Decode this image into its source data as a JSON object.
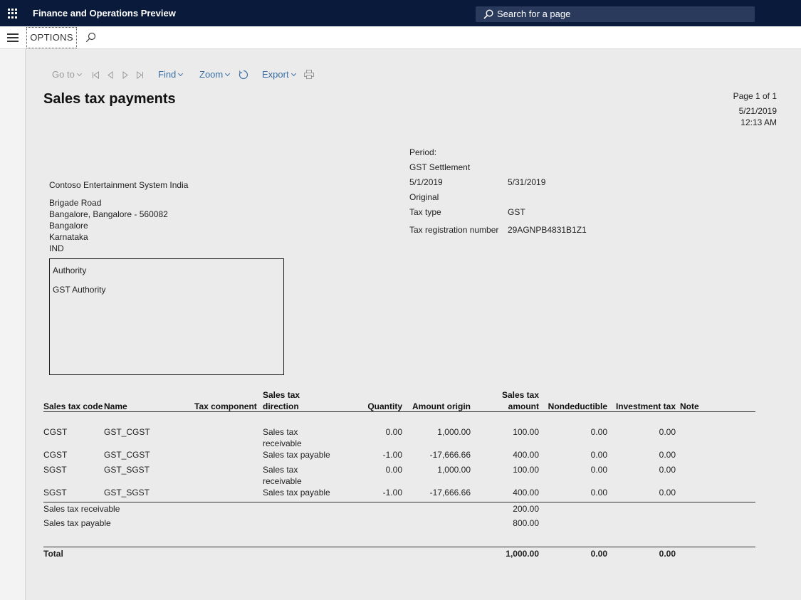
{
  "app": {
    "title": "Finance and Operations Preview",
    "search_placeholder": "Search for a page"
  },
  "actionbar": {
    "options_label": "OPTIONS"
  },
  "report_toolbar": {
    "goto_label": "Go to",
    "find_label": "Find",
    "zoom_label": "Zoom",
    "export_label": "Export"
  },
  "report": {
    "title": "Sales tax payments",
    "page_info": "Page 1 of 1",
    "date": "5/21/2019",
    "time": "12:13 AM",
    "company": {
      "name": "Contoso Entertainment System India",
      "address_line1": "Brigade Road",
      "address_line2": "Bangalore, Bangalore - 560082",
      "city": "Bangalore",
      "state": "Karnataka",
      "country": "IND"
    },
    "period": {
      "label": "Period:",
      "settlement": "GST Settlement",
      "from": "5/1/2019",
      "to": "5/31/2019",
      "version": "Original",
      "tax_type_label": "Tax type",
      "tax_type": "GST",
      "tax_reg_label": "Tax registration number",
      "tax_reg": "29AGNPB4831B1Z1"
    },
    "authority": {
      "label": "Authority",
      "name": "GST Authority"
    },
    "table": {
      "headers": {
        "code": "Sales tax code",
        "name": "Name",
        "component": "Tax component",
        "direction_1": "Sales tax",
        "direction_2": "direction",
        "quantity": "Quantity",
        "amount_origin": "Amount origin",
        "amount_1": "Sales tax",
        "amount_2": "amount",
        "nondeductible": "Nondeductible",
        "investment": "Investment tax",
        "note": "Note"
      },
      "rows": [
        {
          "code": "CGST",
          "name": "GST_CGST",
          "direction_1": "Sales tax",
          "direction_2": "receivable",
          "quantity": "0.00",
          "amount_origin": "1,000.00",
          "amount": "100.00",
          "nondeductible": "0.00",
          "investment": "0.00"
        },
        {
          "code": "CGST",
          "name": "GST_CGST",
          "direction_1": "Sales tax payable",
          "direction_2": "",
          "quantity": "-1.00",
          "amount_origin": "-17,666.66",
          "amount": "400.00",
          "nondeductible": "0.00",
          "investment": "0.00"
        },
        {
          "code": "SGST",
          "name": "GST_SGST",
          "direction_1": "Sales tax",
          "direction_2": "receivable",
          "quantity": "0.00",
          "amount_origin": "1,000.00",
          "amount": "100.00",
          "nondeductible": "0.00",
          "investment": "0.00"
        },
        {
          "code": "SGST",
          "name": "GST_SGST",
          "direction_1": "Sales tax payable",
          "direction_2": "",
          "quantity": "-1.00",
          "amount_origin": "-17,666.66",
          "amount": "400.00",
          "nondeductible": "0.00",
          "investment": "0.00"
        }
      ],
      "summary": {
        "receivable_label": "Sales tax receivable",
        "receivable_value": "200.00",
        "payable_label": "Sales tax payable",
        "payable_value": "800.00"
      },
      "total": {
        "label": "Total",
        "amount": "1,000.00",
        "nondeductible": "0.00",
        "investment": "0.00"
      }
    }
  }
}
